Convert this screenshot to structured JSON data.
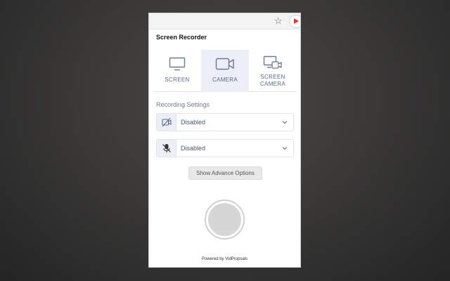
{
  "app": {
    "title": "Screen Recorder"
  },
  "tabs": [
    {
      "label_line1": "SCREEN",
      "label_line2": "",
      "icon": "monitor-icon",
      "active": false
    },
    {
      "label_line1": "CAMERA",
      "label_line2": "",
      "icon": "video-camera-icon",
      "active": true
    },
    {
      "label_line1": "SCREEN",
      "label_line2": "CAMERA",
      "icon": "screen-camera-icon",
      "active": false
    }
  ],
  "settings": {
    "label": "Recording Settings",
    "camera": {
      "value": "Disabled",
      "icon": "camera-off-icon"
    },
    "microphone": {
      "value": "Disabled",
      "icon": "mic-off-icon"
    }
  },
  "advance_button": {
    "label": "Show Advance Options"
  },
  "footer": {
    "text": "Powered by VidPropsals"
  },
  "colors": {
    "accent_tab_bg": "#eceef8",
    "record_button": "#d6d6d6",
    "label_blue": "#6b7a9a",
    "ext_red": "#e53935"
  }
}
